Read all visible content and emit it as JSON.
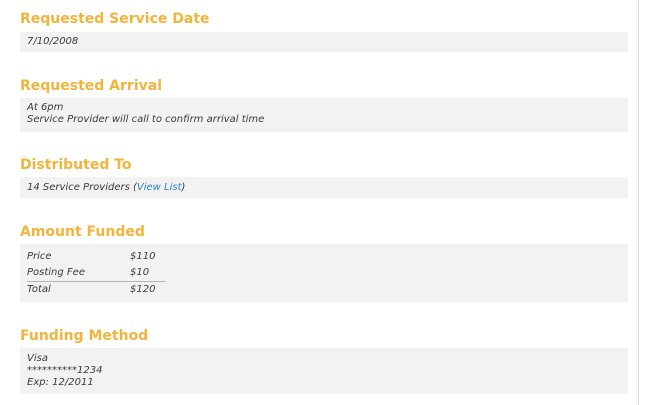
{
  "requested_service_date": {
    "title": "Requested Service Date",
    "value": "7/10/2008"
  },
  "requested_arrival": {
    "title": "Requested Arrival",
    "line1": "At 6pm",
    "line2": "Service Provider will call to confirm arrival time"
  },
  "distributed_to": {
    "title": "Distributed To",
    "count_text": "14 Service Providers (",
    "link_text": "View List",
    "close_paren": ")"
  },
  "amount_funded": {
    "title": "Amount Funded",
    "rows": [
      {
        "label": "Price",
        "value": "$110"
      },
      {
        "label": "Posting Fee",
        "value": "$10"
      }
    ],
    "total": {
      "label": "Total",
      "value": "$120"
    }
  },
  "funding_method": {
    "title": "Funding Method",
    "card_type": "Visa",
    "card_number": "**********1234",
    "expiry": "Exp: 12/2011"
  },
  "colors": {
    "section_title": "#f2b43a",
    "panel_background": "#f2f2f2",
    "link": "#2f7fc7",
    "text": "#3a3a3a"
  }
}
